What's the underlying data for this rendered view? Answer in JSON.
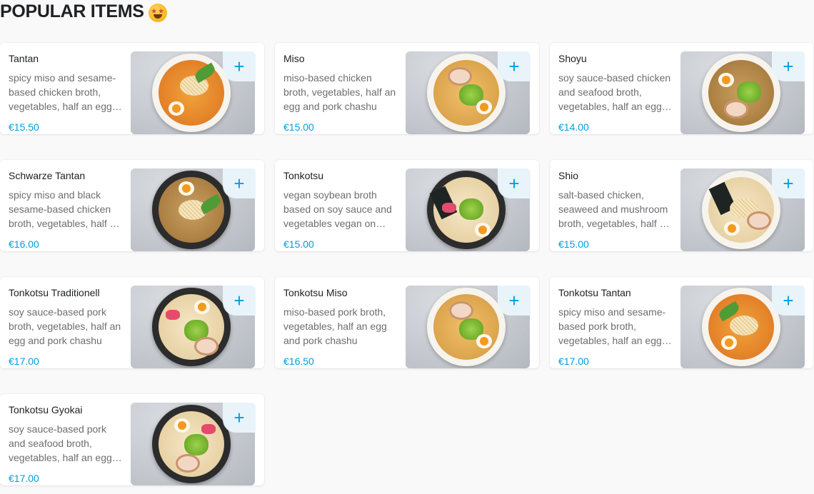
{
  "section": {
    "title": "POPULAR ITEMS",
    "emoji_icon": "star-struck-emoji-icon"
  },
  "accent_color": "#009de0",
  "items": [
    {
      "name": "Tantan",
      "desc": "spicy miso and sesame-based chicken broth, vegetables, half an egg and pork chashu",
      "price": "€15.50"
    },
    {
      "name": "Miso",
      "desc": "miso-based chicken broth, vegetables, half an egg and pork chashu",
      "price": "€15.00"
    },
    {
      "name": "Shoyu",
      "desc": "soy sauce-based chicken and seafood broth, vegetables, half an egg and pork chashu",
      "price": "€14.00"
    },
    {
      "name": "Schwarze Tantan",
      "desc": "spicy miso and black sesame-based chicken broth, vegetables, half an egg and pork chashu",
      "price": "€16.00"
    },
    {
      "name": "Tonkotsu",
      "desc": "vegan soybean broth based on soy sauce and vegetables vegan on request",
      "price": "€15.00"
    },
    {
      "name": "Shio",
      "desc": "salt-based chicken, seaweed and mushroom broth, vegetables, half an egg and pork chashu",
      "price": "€15.00"
    },
    {
      "name": "Tonkotsu Traditionell",
      "desc": "soy sauce-based pork broth, vegetables, half an egg and pork chashu",
      "price": "€17.00"
    },
    {
      "name": "Tonkotsu Miso",
      "desc": "miso-based pork broth, vegetables, half an egg and pork chashu",
      "price": "€16.50"
    },
    {
      "name": "Tonkotsu Tantan",
      "desc": "spicy miso and sesame-based pork broth, vegetables, half an egg and pork chashu",
      "price": "€17.00"
    },
    {
      "name": "Tonkotsu Gyokai",
      "desc": "soy sauce-based pork and seafood broth, vegetables, half an egg and pork chashu",
      "price": "€17.00"
    }
  ],
  "add_button": {
    "label": "+",
    "icon": "plus-icon"
  }
}
